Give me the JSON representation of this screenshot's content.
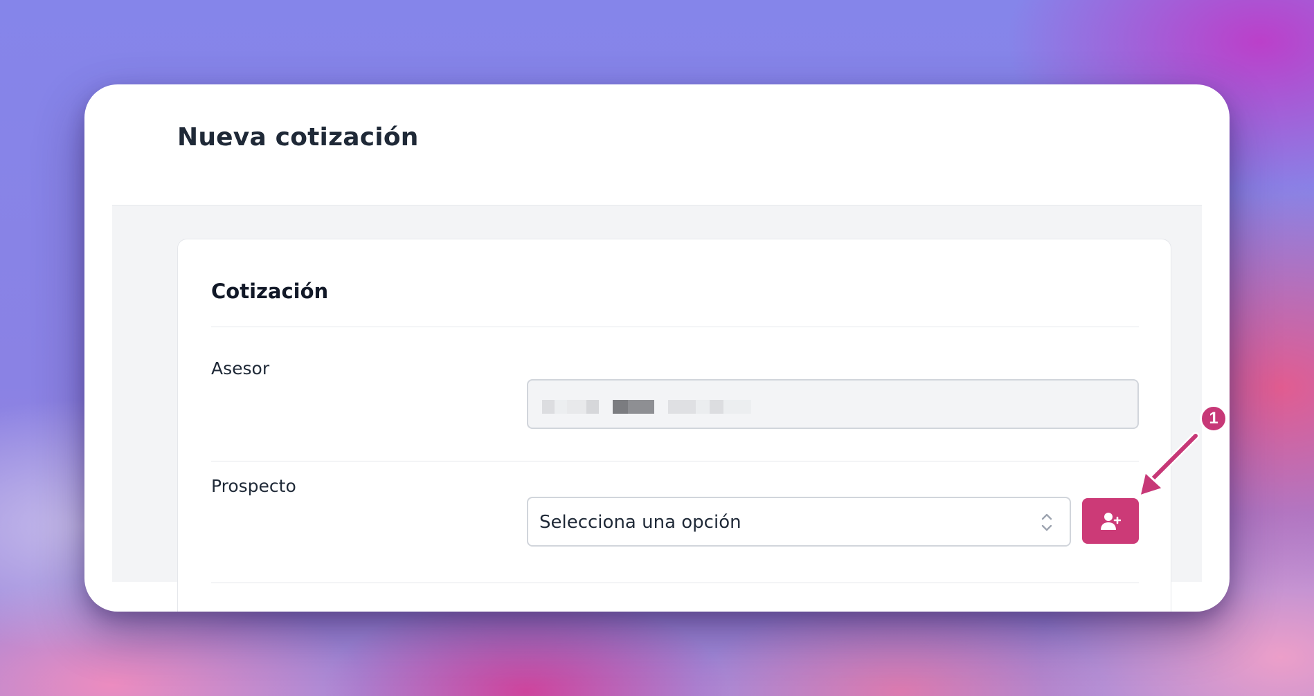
{
  "page": {
    "title": "Nueva cotización"
  },
  "card": {
    "title": "Cotización"
  },
  "fields": {
    "asesor": {
      "label": "Asesor",
      "value_redacted": true
    },
    "prospecto": {
      "label": "Prospecto",
      "placeholder": "Selecciona una opción",
      "add_button_icon": "user-plus-icon"
    }
  },
  "annotation": {
    "badge_number": "1",
    "arrow_target": "add-prospect-button"
  },
  "colors": {
    "accent": "#cc3a77",
    "badge": "#c73877",
    "title_text": "#1f2937",
    "content_bg": "#f3f4f6",
    "card_bg": "#ffffff",
    "border": "#d1d5db"
  },
  "icons": {
    "select_chevrons": "chevron-up-down-icon",
    "add_prospect": "user-plus-icon",
    "annotation_arrow": "arrow-icon"
  }
}
